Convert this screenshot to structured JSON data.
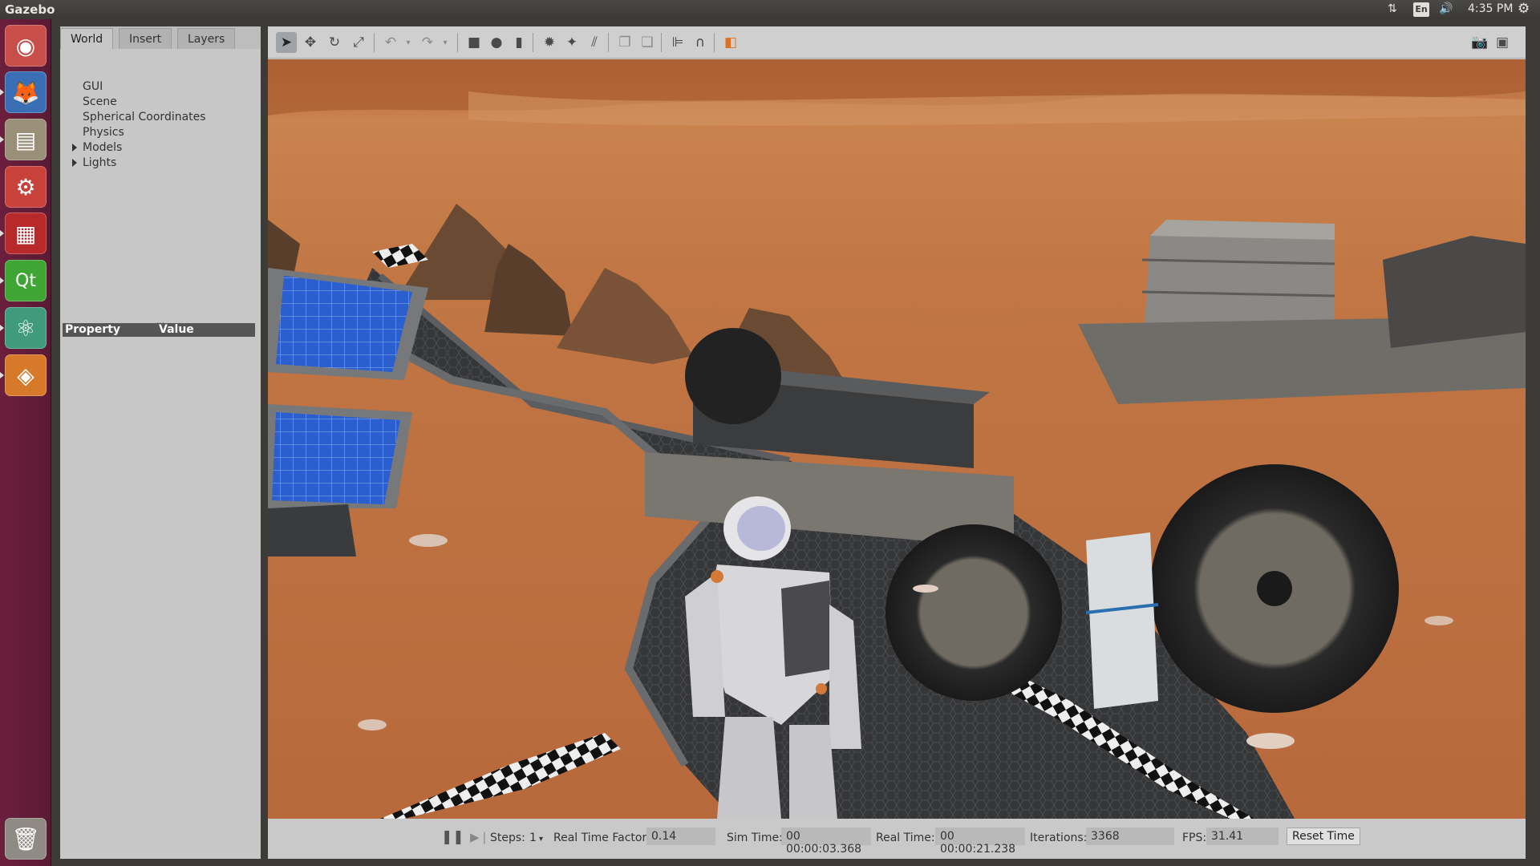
{
  "top_panel": {
    "app_title": "Gazebo",
    "lang": "En",
    "time": "4:35 PM"
  },
  "launcher": {
    "items": [
      {
        "name": "ubuntu-dash-icon",
        "glyph": "◉",
        "bg": "#c84e4a"
      },
      {
        "name": "firefox-icon",
        "glyph": "🦊",
        "bg": "#3a6fb5"
      },
      {
        "name": "file-manager-icon",
        "glyph": "▤",
        "bg": "#9a8f78"
      },
      {
        "name": "system-settings-icon",
        "glyph": "⚙",
        "bg": "#c8413b"
      },
      {
        "name": "terminal-like-icon",
        "glyph": "▦",
        "bg": "#b82a2a"
      },
      {
        "name": "qt-creator-icon",
        "glyph": "Qt",
        "bg": "#3fa535"
      },
      {
        "name": "atom-icon",
        "glyph": "⚛",
        "bg": "#3f9b7c"
      },
      {
        "name": "gazebo-icon",
        "glyph": "◈",
        "bg": "#d67a2a"
      },
      {
        "name": "trash-icon",
        "glyph": "🗑",
        "bg": "#8f8a84"
      }
    ]
  },
  "left_panel": {
    "tabs": [
      "World",
      "Insert",
      "Layers"
    ],
    "tree": [
      "GUI",
      "Scene",
      "Spherical Coordinates",
      "Physics",
      "Models",
      "Lights"
    ],
    "property_header": {
      "col1": "Property",
      "col2": "Value"
    }
  },
  "statusbar": {
    "steps_label": "Steps:",
    "steps_value": "1",
    "rtf_label": "Real Time Factor:",
    "rtf_value": "0.14",
    "sim_label": "Sim Time:",
    "sim_value": "00 00:00:03.368",
    "real_label": "Real Time:",
    "real_value": "00 00:00:21.238",
    "iter_label": "Iterations:",
    "iter_value": "3368",
    "fps_label": "FPS:",
    "fps_value": "31.41",
    "reset_label": "Reset Time"
  }
}
